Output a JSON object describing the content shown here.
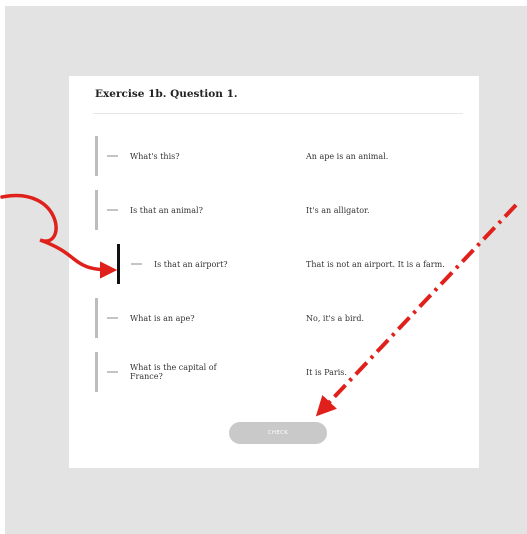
{
  "exercise": {
    "title": "Exercise 1b. Question 1.",
    "check_label": "CHECK",
    "pairs": [
      {
        "question": "What's this?",
        "answer": "An ape is an animal."
      },
      {
        "question": "Is that an animal?",
        "answer": "It's an alligator."
      },
      {
        "question": "Is that an airport?",
        "answer": "That is not an airport. It is a farm."
      },
      {
        "question": "What is an ape?",
        "answer": "No, it's a bird."
      },
      {
        "question": "What is the capital of France?",
        "answer": "It is Paris."
      }
    ]
  },
  "annotations": {
    "color": "#e0201b",
    "curved_arrow_target": "Is that an airport?",
    "dashed_arrow_target": "CHECK"
  }
}
